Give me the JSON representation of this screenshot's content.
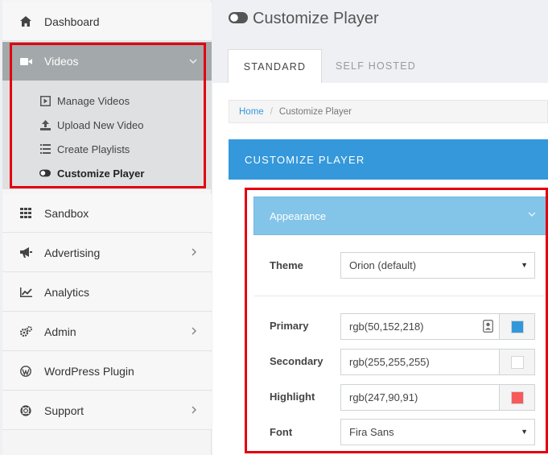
{
  "sidebar": {
    "items": [
      {
        "label": "Dashboard",
        "icon": "home-icon"
      },
      {
        "label": "Videos",
        "icon": "video-camera-icon",
        "active": true
      },
      {
        "label": "Sandbox",
        "icon": "grid-icon"
      },
      {
        "label": "Advertising",
        "icon": "megaphone-icon"
      },
      {
        "label": "Analytics",
        "icon": "line-chart-icon"
      },
      {
        "label": "Admin",
        "icon": "gears-icon"
      },
      {
        "label": "WordPress Plugin",
        "icon": "wordpress-icon"
      },
      {
        "label": "Support",
        "icon": "lifebuoy-icon"
      }
    ],
    "submenu": [
      {
        "label": "Manage Videos",
        "icon": "play-square-icon"
      },
      {
        "label": "Upload New Video",
        "icon": "upload-icon"
      },
      {
        "label": "Create Playlists",
        "icon": "list-icon"
      },
      {
        "label": "Customize Player",
        "icon": "toggle-icon",
        "current": true
      }
    ]
  },
  "page": {
    "title": "Customize Player",
    "tabs": [
      "STANDARD",
      "SELF HOSTED"
    ],
    "breadcrumb": {
      "home": "Home",
      "current": "Customize Player"
    },
    "panel_title": "CUSTOMIZE PLAYER",
    "accordion_title": "Appearance"
  },
  "form": {
    "theme": {
      "label": "Theme",
      "value": "Orion (default)"
    },
    "primary": {
      "label": "Primary",
      "value": "rgb(50,152,218)",
      "swatch": "#3298da"
    },
    "secondary": {
      "label": "Secondary",
      "value": "rgb(255,255,255)",
      "swatch": "#ffffff"
    },
    "highlight": {
      "label": "Highlight",
      "value": "rgb(247,90,91)",
      "swatch": "#f75a5b"
    },
    "font": {
      "label": "Font",
      "value": "Fira Sans"
    }
  },
  "colors": {
    "accent": "#3498db",
    "accordion": "#83c4e9",
    "annotation": "#e3000f"
  }
}
